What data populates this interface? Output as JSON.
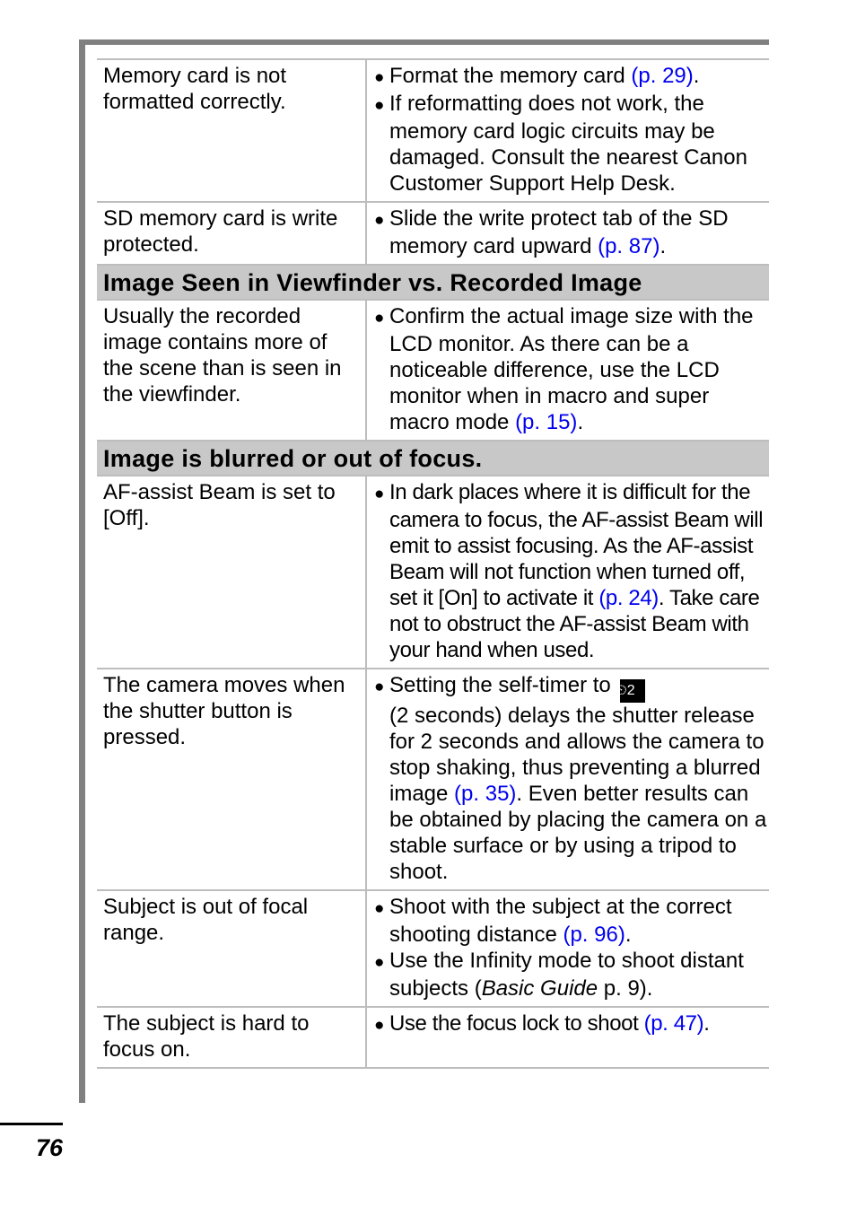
{
  "rows": [
    {
      "cause": "Memory card is not formatted correctly.",
      "bullets": [
        {
          "text": "Format the memory card ",
          "link": "(p. 29)",
          "after": "."
        },
        {
          "text": "If reformatting does not work, the memory card logic circuits may be damaged. Consult the nearest Canon Customer Support Help Desk.",
          "link": "",
          "after": ""
        }
      ]
    },
    {
      "cause": "SD memory card is write protected.",
      "bullets": [
        {
          "text": "Slide the write protect tab of the SD memory card upward ",
          "link": "(p. 87)",
          "after": "."
        }
      ]
    }
  ],
  "section2": {
    "title": "Image Seen in Viewfinder vs. Recorded Image",
    "rows": [
      {
        "cause": "Usually the recorded image contains more of the scene than is seen in the viewfinder.",
        "bullets": [
          {
            "text": "Confirm the actual image size with the LCD monitor. As there can be a noticeable difference, use the LCD monitor when in macro and super macro mode ",
            "link": "(p. 15)",
            "after": "."
          }
        ]
      }
    ]
  },
  "section3": {
    "title": "Image is blurred or out of focus.",
    "rows": [
      {
        "cause": "AF-assist Beam is set to [Off].",
        "b1": "In dark places where it is difficult for the camera to focus, the AF-assist Beam will emit to assist focusing. As the AF-assist Beam will not function when turned off, set it [On] to activate it ",
        "l1": "(p. 24)",
        "a1": ". Take care not to obstruct the AF-assist Beam with your hand when used."
      },
      {
        "cause": "The camera moves when the shutter button is pressed.",
        "b1": "Setting the self-timer to ",
        "icon": "self-timer-2s-icon",
        "icon_glyph": "⏲2",
        "b1b": " (2 seconds) delays the shutter release for 2 seconds and allows the camera to stop shaking, thus preventing a blurred image ",
        "l1": "(p. 35)",
        "a1": ". Even better results can be obtained by placing the camera on a stable surface or by using a tripod to shoot."
      },
      {
        "cause": "Subject is out of focal range.",
        "b1": "Shoot with the subject at the correct shooting distance ",
        "l1": "(p. 96)",
        "a1": ".",
        "b2": "Use the Infinity mode to shoot distant subjects (",
        "b2i": "Basic Guide",
        "b2a": " p. 9)."
      },
      {
        "cause": "The subject is hard to focus on.",
        "b1": "Use the focus lock to shoot ",
        "l1": "(p. 47)",
        "a1": "."
      }
    ]
  },
  "page_number": "76"
}
